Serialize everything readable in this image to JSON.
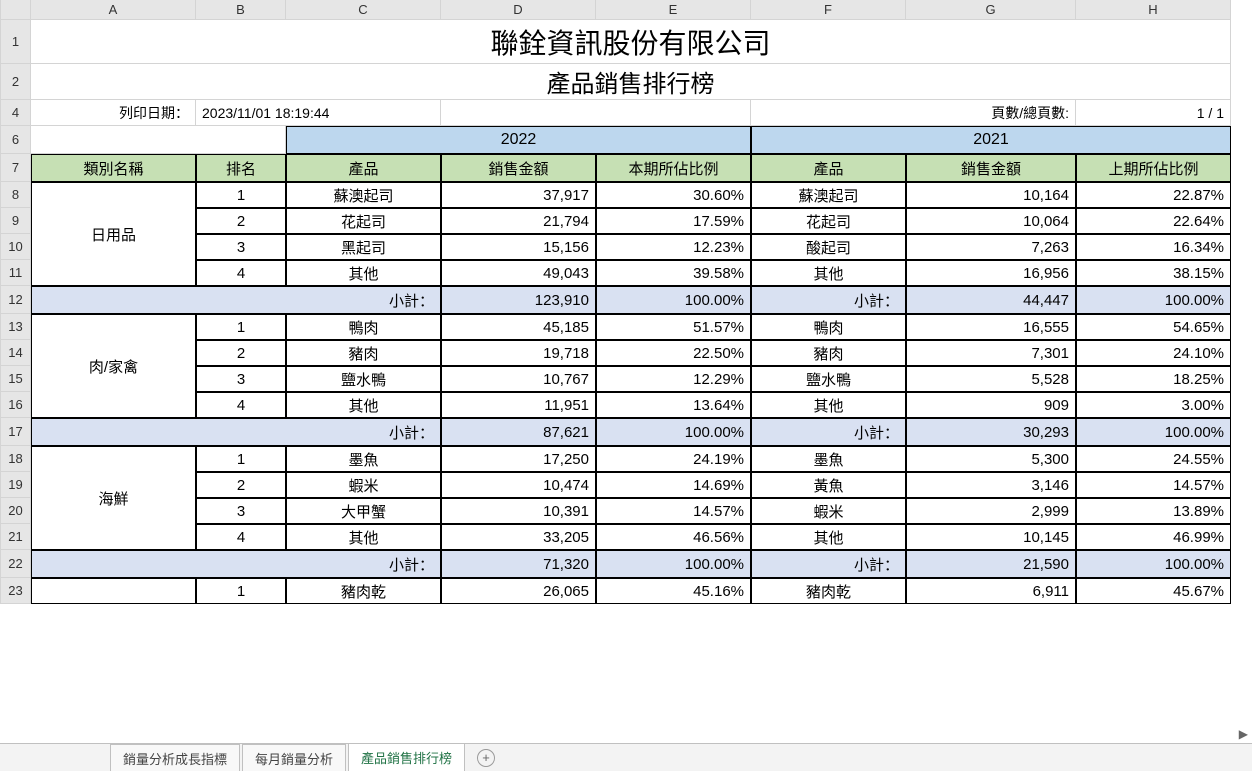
{
  "columns": [
    "A",
    "B",
    "C",
    "D",
    "E",
    "F",
    "G",
    "H"
  ],
  "rowNumbers": [
    "1",
    "2",
    "4",
    "6",
    "7",
    "8",
    "9",
    "10",
    "11",
    "12",
    "13",
    "14",
    "15",
    "16",
    "17",
    "18",
    "19",
    "20",
    "21",
    "22",
    "23"
  ],
  "title1": "聯銓資訊股份有限公司",
  "title2": "產品銷售排行榜",
  "printLabel": "列印日期：",
  "printDate": "2023/11/01 18:19:44",
  "pageLabel": "頁數/總頁數:",
  "pageValue": "1 / 1",
  "years": {
    "y1": "2022",
    "y2": "2021"
  },
  "headers": {
    "cat": "類別名稱",
    "rank": "排名",
    "prod": "產品",
    "amt": "銷售金額",
    "pct1": "本期所佔比例",
    "pct2": "上期所佔比例"
  },
  "subtotalLabel": "小計：",
  "groups": [
    {
      "name": "日用品",
      "rows": [
        {
          "rank": "1",
          "p1": "蘇澳起司",
          "a1": "37,917",
          "r1": "30.60%",
          "p2": "蘇澳起司",
          "a2": "10,164",
          "r2": "22.87%"
        },
        {
          "rank": "2",
          "p1": "花起司",
          "a1": "21,794",
          "r1": "17.59%",
          "p2": "花起司",
          "a2": "10,064",
          "r2": "22.64%"
        },
        {
          "rank": "3",
          "p1": "黑起司",
          "a1": "15,156",
          "r1": "12.23%",
          "p2": "酸起司",
          "a2": "7,263",
          "r2": "16.34%"
        },
        {
          "rank": "4",
          "p1": "其他",
          "a1": "49,043",
          "r1": "39.58%",
          "p2": "其他",
          "a2": "16,956",
          "r2": "38.15%"
        }
      ],
      "sub": {
        "a1": "123,910",
        "r1": "100.00%",
        "a2": "44,447",
        "r2": "100.00%"
      }
    },
    {
      "name": "肉/家禽",
      "rows": [
        {
          "rank": "1",
          "p1": "鴨肉",
          "a1": "45,185",
          "r1": "51.57%",
          "p2": "鴨肉",
          "a2": "16,555",
          "r2": "54.65%"
        },
        {
          "rank": "2",
          "p1": "豬肉",
          "a1": "19,718",
          "r1": "22.50%",
          "p2": "豬肉",
          "a2": "7,301",
          "r2": "24.10%"
        },
        {
          "rank": "3",
          "p1": "鹽水鴨",
          "a1": "10,767",
          "r1": "12.29%",
          "p2": "鹽水鴨",
          "a2": "5,528",
          "r2": "18.25%"
        },
        {
          "rank": "4",
          "p1": "其他",
          "a1": "11,951",
          "r1": "13.64%",
          "p2": "其他",
          "a2": "909",
          "r2": "3.00%"
        }
      ],
      "sub": {
        "a1": "87,621",
        "r1": "100.00%",
        "a2": "30,293",
        "r2": "100.00%"
      }
    },
    {
      "name": "海鮮",
      "rows": [
        {
          "rank": "1",
          "p1": "墨魚",
          "a1": "17,250",
          "r1": "24.19%",
          "p2": "墨魚",
          "a2": "5,300",
          "r2": "24.55%"
        },
        {
          "rank": "2",
          "p1": "蝦米",
          "a1": "10,474",
          "r1": "14.69%",
          "p2": "黃魚",
          "a2": "3,146",
          "r2": "14.57%"
        },
        {
          "rank": "3",
          "p1": "大甲蟹",
          "a1": "10,391",
          "r1": "14.57%",
          "p2": "蝦米",
          "a2": "2,999",
          "r2": "13.89%"
        },
        {
          "rank": "4",
          "p1": "其他",
          "a1": "33,205",
          "r1": "46.56%",
          "p2": "其他",
          "a2": "10,145",
          "r2": "46.99%"
        }
      ],
      "sub": {
        "a1": "71,320",
        "r1": "100.00%",
        "a2": "21,590",
        "r2": "100.00%"
      }
    }
  ],
  "extraRow": {
    "rank": "1",
    "p1": "豬肉乾",
    "a1": "26,065",
    "r1": "45.16%",
    "p2": "豬肉乾",
    "a2": "6,911",
    "r2": "45.67%"
  },
  "tabs": {
    "t1": "銷量分析成長指標",
    "t2": "每月銷量分析",
    "t3": "產品銷售排行榜"
  }
}
